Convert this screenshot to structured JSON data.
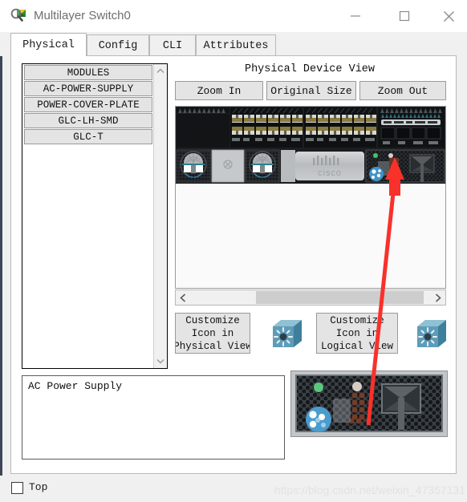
{
  "window": {
    "title": "Multilayer Switch0",
    "app_icon": "packet-tracer-icon",
    "minimize_label": "—",
    "maximize_label": "□",
    "close_label": "✕"
  },
  "tabs": [
    {
      "label": "Physical",
      "active": true
    },
    {
      "label": "Config",
      "active": false
    },
    {
      "label": "CLI",
      "active": false
    },
    {
      "label": "Attributes",
      "active": false
    }
  ],
  "modules": {
    "header": "MODULES",
    "items": [
      {
        "label": "MODULES"
      },
      {
        "label": "AC-POWER-SUPPLY"
      },
      {
        "label": "POWER-COVER-PLATE"
      },
      {
        "label": "GLC-LH-SMD"
      },
      {
        "label": "GLC-T"
      }
    ],
    "scroll_up_icon": "chevron-up-icon",
    "scroll_down_icon": "chevron-down-icon"
  },
  "device_view": {
    "title": "Physical Device View",
    "zoom_in": "Zoom In",
    "original_size": "Original Size",
    "zoom_out": "Zoom Out",
    "scroll_left_icon": "chevron-left-icon",
    "scroll_right_icon": "chevron-right-icon",
    "device_model": "cisco-multilayer-switch-rear"
  },
  "customize": {
    "physical_view": "Customize\nIcon in\nPhysical View",
    "physical_line1": "Customize",
    "physical_line2": "Icon in",
    "physical_line3": "Physical View",
    "logical_line1": "Customize",
    "logical_line2": "Icon in",
    "logical_line3": "Logical View",
    "icon_name": "cisco-switch-3d-icon"
  },
  "description": {
    "text": "AC Power Supply"
  },
  "preview": {
    "module_name": "ac-power-supply-module"
  },
  "footer": {
    "top_label": "Top",
    "top_checked": false,
    "watermark": "https://blog.csdn.net/weixin_47357131"
  },
  "annotation": {
    "arrow_color": "#f9312b",
    "arrow_name": "red-pointer-arrow"
  },
  "colors": {
    "accent": "#f9312b",
    "panel_bg": "#f0f0f0",
    "button_face": "#e4e4e4",
    "device_dark": "#1b1d1f",
    "switch_icon": "#4f8ba3"
  }
}
